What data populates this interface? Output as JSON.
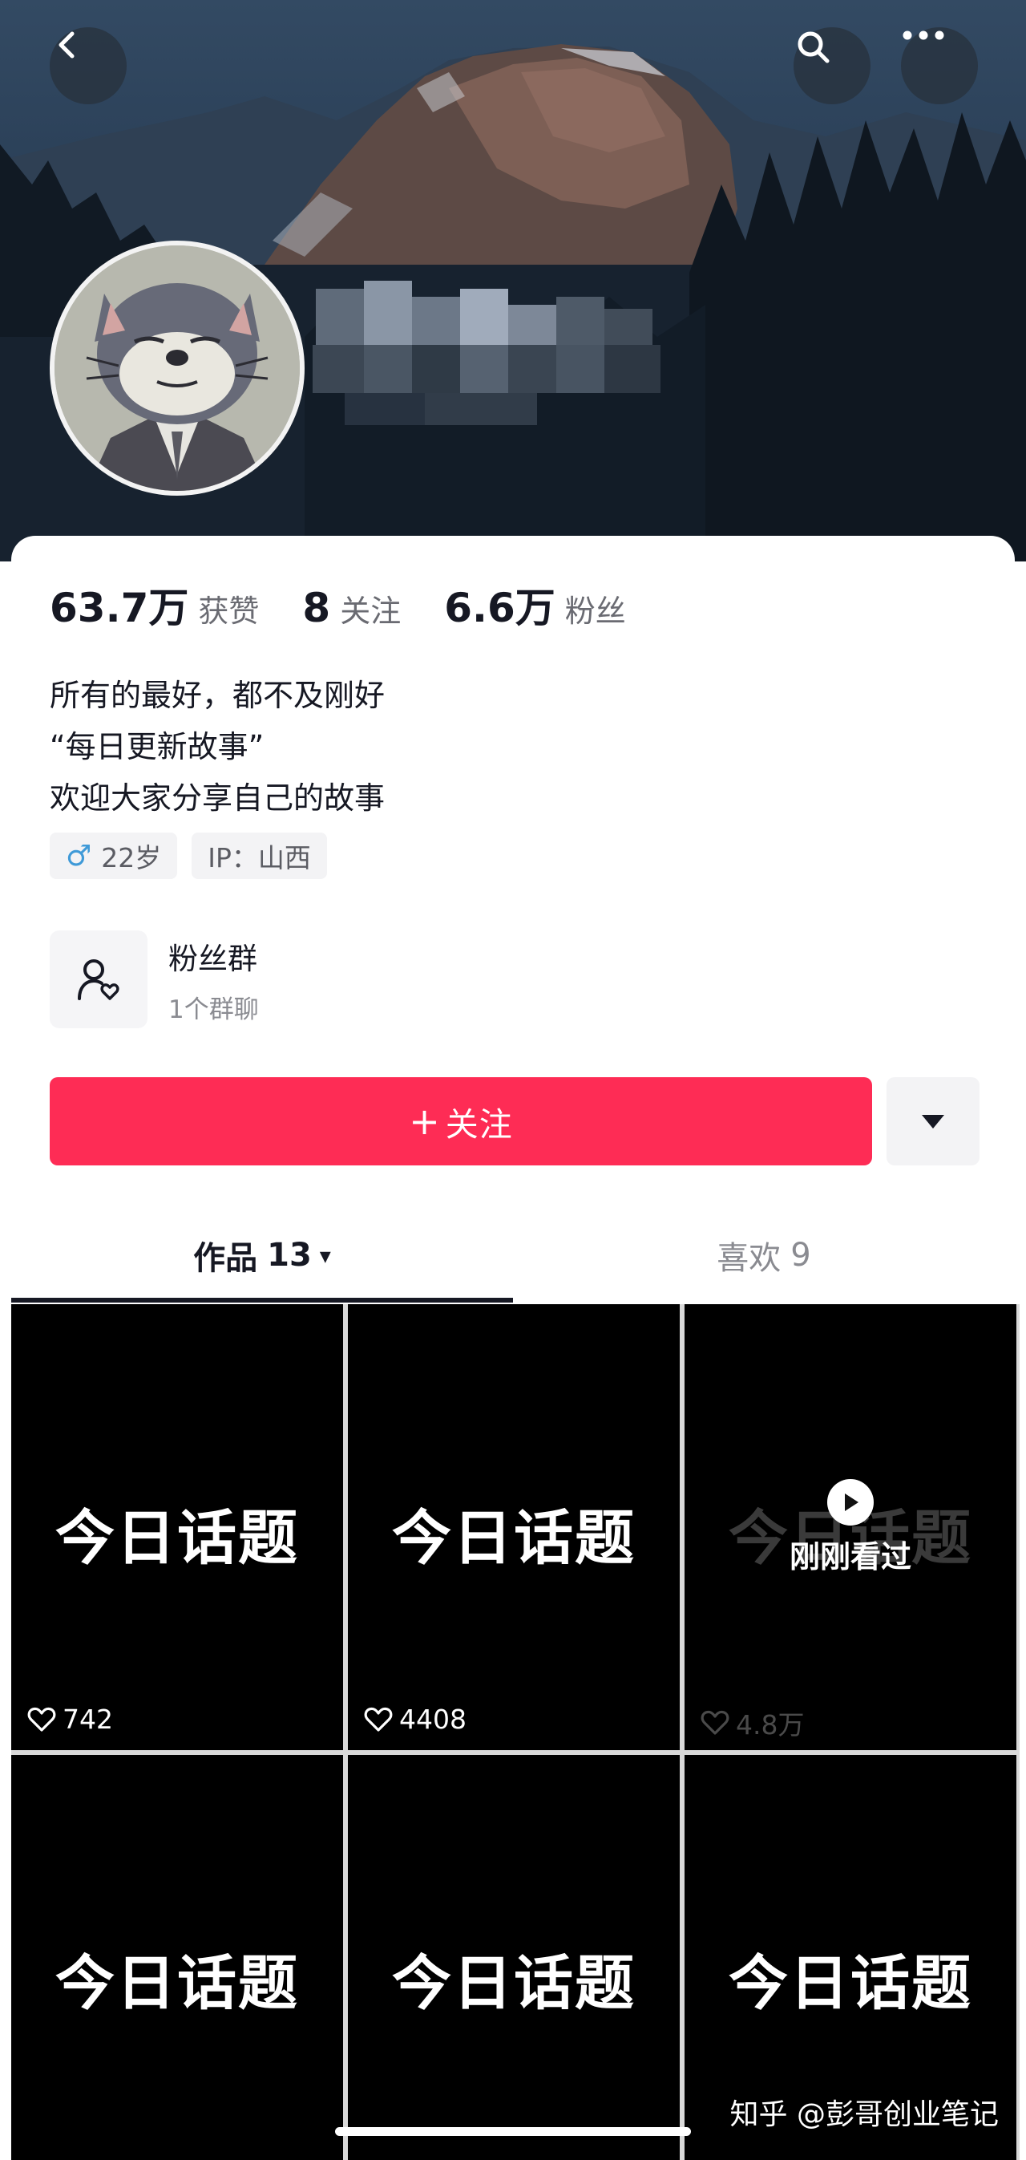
{
  "header": {
    "back_icon": "chevron-left-icon",
    "search_icon": "search-icon",
    "more_icon": "more-dots-icon"
  },
  "profile": {
    "stats": [
      {
        "value": "63.7万",
        "label": "获赞"
      },
      {
        "value": "8",
        "label": "关注"
      },
      {
        "value": "6.6万",
        "label": "粉丝"
      }
    ],
    "bio": [
      "所有的最好，都不及刚好",
      "“每日更新故事”",
      "欢迎大家分享自己的故事"
    ],
    "tags": {
      "gender_symbol": "♂",
      "age": "22岁",
      "ip": "IP：山西"
    },
    "fan_group": {
      "title": "粉丝群",
      "subtitle": "1个群聊"
    },
    "follow_label": "关注",
    "follow_plus": "+"
  },
  "tabs": {
    "works": {
      "label": "作品",
      "count": "13",
      "caret": "▾"
    },
    "likes": {
      "label": "喜欢",
      "count": "9"
    }
  },
  "videos": [
    {
      "title": "今日话题",
      "likes": "742"
    },
    {
      "title": "今日话题",
      "likes": "4408"
    },
    {
      "title": "今日话题",
      "likes": "4.8万",
      "seen_label": "刚刚看过"
    },
    {
      "title": "今日话题"
    },
    {
      "title": "今日话题"
    },
    {
      "title": "今日话题"
    }
  ],
  "watermark": "知乎 @彭哥创业笔记",
  "colors": {
    "accent": "#fe2c55",
    "tile_bg": "#000000"
  }
}
